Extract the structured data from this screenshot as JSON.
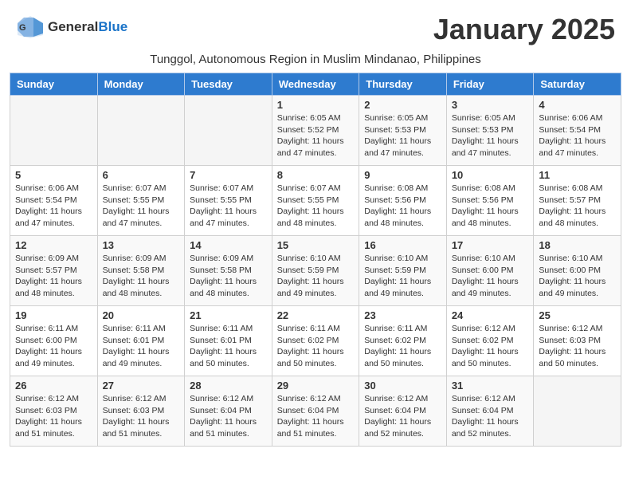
{
  "header": {
    "logo_general": "General",
    "logo_blue": "Blue",
    "month_title": "January 2025",
    "subtitle": "Tunggol, Autonomous Region in Muslim Mindanao, Philippines"
  },
  "days_of_week": [
    "Sunday",
    "Monday",
    "Tuesday",
    "Wednesday",
    "Thursday",
    "Friday",
    "Saturday"
  ],
  "weeks": [
    [
      {
        "day": "",
        "info": ""
      },
      {
        "day": "",
        "info": ""
      },
      {
        "day": "",
        "info": ""
      },
      {
        "day": "1",
        "info": "Sunrise: 6:05 AM\nSunset: 5:52 PM\nDaylight: 11 hours and 47 minutes."
      },
      {
        "day": "2",
        "info": "Sunrise: 6:05 AM\nSunset: 5:53 PM\nDaylight: 11 hours and 47 minutes."
      },
      {
        "day": "3",
        "info": "Sunrise: 6:05 AM\nSunset: 5:53 PM\nDaylight: 11 hours and 47 minutes."
      },
      {
        "day": "4",
        "info": "Sunrise: 6:06 AM\nSunset: 5:54 PM\nDaylight: 11 hours and 47 minutes."
      }
    ],
    [
      {
        "day": "5",
        "info": "Sunrise: 6:06 AM\nSunset: 5:54 PM\nDaylight: 11 hours and 47 minutes."
      },
      {
        "day": "6",
        "info": "Sunrise: 6:07 AM\nSunset: 5:55 PM\nDaylight: 11 hours and 47 minutes."
      },
      {
        "day": "7",
        "info": "Sunrise: 6:07 AM\nSunset: 5:55 PM\nDaylight: 11 hours and 47 minutes."
      },
      {
        "day": "8",
        "info": "Sunrise: 6:07 AM\nSunset: 5:55 PM\nDaylight: 11 hours and 48 minutes."
      },
      {
        "day": "9",
        "info": "Sunrise: 6:08 AM\nSunset: 5:56 PM\nDaylight: 11 hours and 48 minutes."
      },
      {
        "day": "10",
        "info": "Sunrise: 6:08 AM\nSunset: 5:56 PM\nDaylight: 11 hours and 48 minutes."
      },
      {
        "day": "11",
        "info": "Sunrise: 6:08 AM\nSunset: 5:57 PM\nDaylight: 11 hours and 48 minutes."
      }
    ],
    [
      {
        "day": "12",
        "info": "Sunrise: 6:09 AM\nSunset: 5:57 PM\nDaylight: 11 hours and 48 minutes."
      },
      {
        "day": "13",
        "info": "Sunrise: 6:09 AM\nSunset: 5:58 PM\nDaylight: 11 hours and 48 minutes."
      },
      {
        "day": "14",
        "info": "Sunrise: 6:09 AM\nSunset: 5:58 PM\nDaylight: 11 hours and 48 minutes."
      },
      {
        "day": "15",
        "info": "Sunrise: 6:10 AM\nSunset: 5:59 PM\nDaylight: 11 hours and 49 minutes."
      },
      {
        "day": "16",
        "info": "Sunrise: 6:10 AM\nSunset: 5:59 PM\nDaylight: 11 hours and 49 minutes."
      },
      {
        "day": "17",
        "info": "Sunrise: 6:10 AM\nSunset: 6:00 PM\nDaylight: 11 hours and 49 minutes."
      },
      {
        "day": "18",
        "info": "Sunrise: 6:10 AM\nSunset: 6:00 PM\nDaylight: 11 hours and 49 minutes."
      }
    ],
    [
      {
        "day": "19",
        "info": "Sunrise: 6:11 AM\nSunset: 6:00 PM\nDaylight: 11 hours and 49 minutes."
      },
      {
        "day": "20",
        "info": "Sunrise: 6:11 AM\nSunset: 6:01 PM\nDaylight: 11 hours and 49 minutes."
      },
      {
        "day": "21",
        "info": "Sunrise: 6:11 AM\nSunset: 6:01 PM\nDaylight: 11 hours and 50 minutes."
      },
      {
        "day": "22",
        "info": "Sunrise: 6:11 AM\nSunset: 6:02 PM\nDaylight: 11 hours and 50 minutes."
      },
      {
        "day": "23",
        "info": "Sunrise: 6:11 AM\nSunset: 6:02 PM\nDaylight: 11 hours and 50 minutes."
      },
      {
        "day": "24",
        "info": "Sunrise: 6:12 AM\nSunset: 6:02 PM\nDaylight: 11 hours and 50 minutes."
      },
      {
        "day": "25",
        "info": "Sunrise: 6:12 AM\nSunset: 6:03 PM\nDaylight: 11 hours and 50 minutes."
      }
    ],
    [
      {
        "day": "26",
        "info": "Sunrise: 6:12 AM\nSunset: 6:03 PM\nDaylight: 11 hours and 51 minutes."
      },
      {
        "day": "27",
        "info": "Sunrise: 6:12 AM\nSunset: 6:03 PM\nDaylight: 11 hours and 51 minutes."
      },
      {
        "day": "28",
        "info": "Sunrise: 6:12 AM\nSunset: 6:04 PM\nDaylight: 11 hours and 51 minutes."
      },
      {
        "day": "29",
        "info": "Sunrise: 6:12 AM\nSunset: 6:04 PM\nDaylight: 11 hours and 51 minutes."
      },
      {
        "day": "30",
        "info": "Sunrise: 6:12 AM\nSunset: 6:04 PM\nDaylight: 11 hours and 52 minutes."
      },
      {
        "day": "31",
        "info": "Sunrise: 6:12 AM\nSunset: 6:04 PM\nDaylight: 11 hours and 52 minutes."
      },
      {
        "day": "",
        "info": ""
      }
    ]
  ]
}
